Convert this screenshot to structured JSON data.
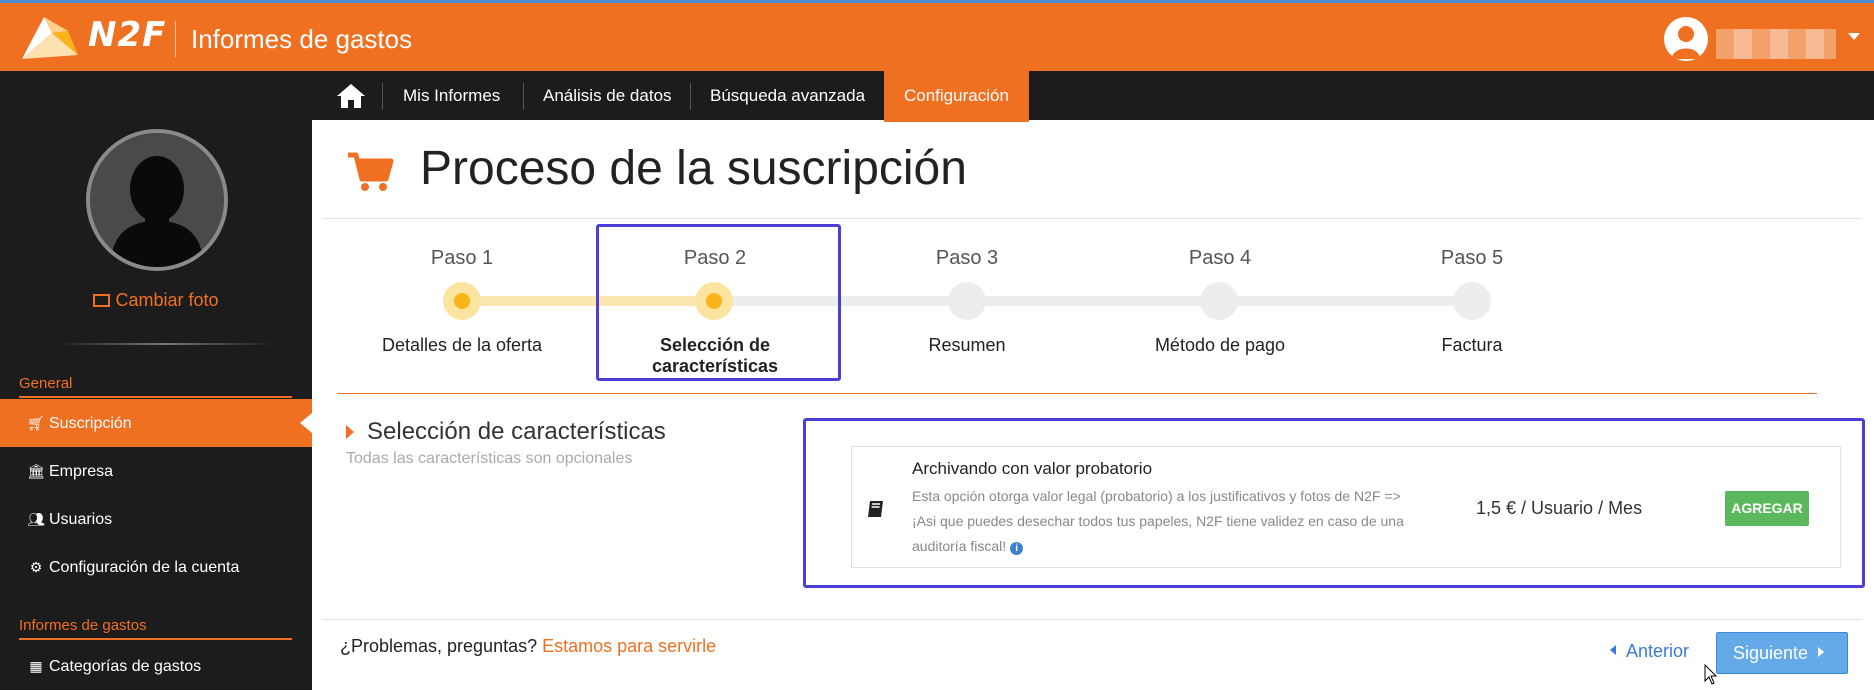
{
  "colors": {
    "brand": "#f07022",
    "dark": "#1c1c1c",
    "step_active": "#f9b51a",
    "highlight": "#4a3fd8",
    "link": "#3a7bd5",
    "success": "#5cb85c"
  },
  "header": {
    "logo_text": "N2F",
    "app_title": "Informes de gastos",
    "avatar_icon": "user-avatar-icon"
  },
  "nav": {
    "home_icon": "home-icon",
    "items": [
      {
        "label": "Mis Informes",
        "active": false
      },
      {
        "label": "Análisis de datos",
        "active": false
      },
      {
        "label": "Búsqueda avanzada",
        "active": false
      },
      {
        "label": "Configuración",
        "active": true
      }
    ]
  },
  "sidebar": {
    "change_photo": "Cambiar foto",
    "sections": [
      {
        "title": "General",
        "items": [
          {
            "label": "Suscripción",
            "icon": "cart-icon",
            "active": true
          },
          {
            "label": "Empresa",
            "icon": "bank-icon",
            "active": false
          },
          {
            "label": "Usuarios",
            "icon": "users-icon",
            "active": false
          },
          {
            "label": "Configuración de la cuenta",
            "icon": "cogs-icon",
            "active": false
          }
        ]
      },
      {
        "title": "Informes de gastos",
        "items": [
          {
            "label": "Categorías de gastos",
            "icon": "grid-icon",
            "active": false
          }
        ]
      }
    ]
  },
  "page": {
    "title": "Proceso de la suscripción",
    "icon": "cart-icon"
  },
  "steps": [
    {
      "label": "Paso 1",
      "name": "Detalles de la oferta",
      "done": true
    },
    {
      "label": "Paso 2",
      "name": "Selección de características",
      "done": true,
      "current": true
    },
    {
      "label": "Paso 3",
      "name": "Resumen",
      "done": false
    },
    {
      "label": "Paso 4",
      "name": "Método de pago",
      "done": false
    },
    {
      "label": "Paso 5",
      "name": "Factura",
      "done": false
    }
  ],
  "features": {
    "title": "Selección de características",
    "subtitle": "Todas las características son opcionales",
    "items": [
      {
        "title": "Archivando con valor probatorio",
        "desc_line1": "Esta opción otorga valor legal (probatorio) a los justificativos y fotos de N2F =>",
        "desc_line2": "¡Asi que puedes desechar todos tus papeles, N2F tiene validez en caso de una",
        "desc_line3": "auditoría fiscal!",
        "price": "1,5 € / Usuario / Mes",
        "action": "AGREGAR"
      }
    ]
  },
  "footer": {
    "help_text": "¿Problemas, preguntas?",
    "help_link": "Estamos para servirle",
    "prev": "Anterior",
    "next": "Siguiente"
  }
}
